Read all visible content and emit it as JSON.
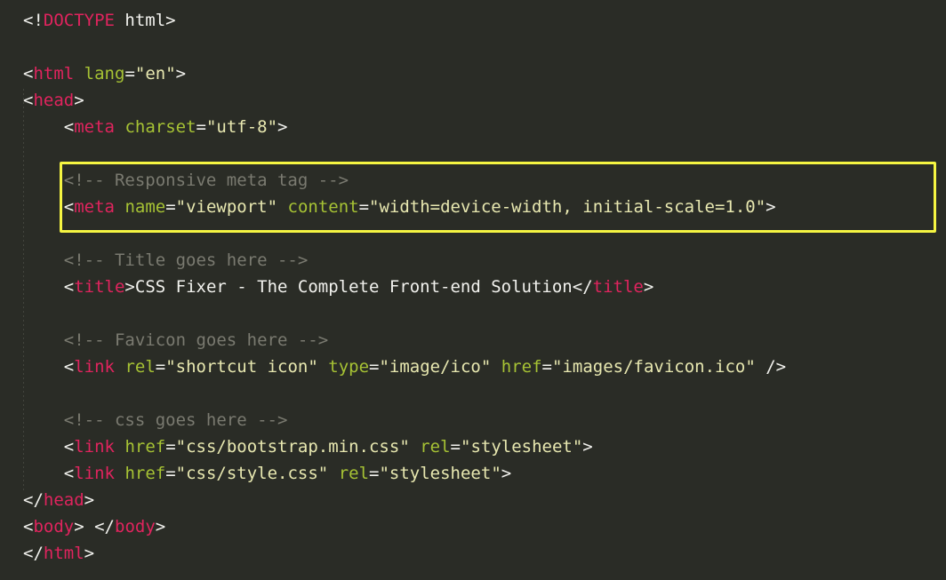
{
  "editor": {
    "language": "html",
    "background_color": "#2a2c26",
    "default_text_color": "#f2f2ee",
    "font_size_px": 19,
    "line_height_px": 30,
    "colors": {
      "tag": "#e0245e",
      "attribute_name": "#a6c234",
      "attribute_value": "#e8e8b0",
      "comment": "#7a7a70",
      "punctuation": "#f2f2ee",
      "text": "#f2f2ee",
      "highlight_border": "#f5f542",
      "indent_guide": "#43453d"
    }
  },
  "highlight": {
    "label": "viewport-meta-emphasis",
    "border_color": "#f5f542",
    "covers_lines": [
      6,
      7
    ]
  },
  "code": {
    "lines": [
      {
        "n": 1,
        "text": "<!DOCTYPE html>",
        "tokens": [
          {
            "t": "punct",
            "v": "<!"
          },
          {
            "t": "tag",
            "v": "DOCTYPE"
          },
          {
            "t": "text",
            "v": " html"
          },
          {
            "t": "punct",
            "v": ">"
          }
        ]
      },
      {
        "n": 2,
        "text": "",
        "tokens": []
      },
      {
        "n": 3,
        "text": "<html lang=\"en\">",
        "tokens": [
          {
            "t": "punct",
            "v": "<"
          },
          {
            "t": "tag",
            "v": "html"
          },
          {
            "t": "text",
            "v": " "
          },
          {
            "t": "attr",
            "v": "lang"
          },
          {
            "t": "punct",
            "v": "="
          },
          {
            "t": "string",
            "v": "\"en\""
          },
          {
            "t": "punct",
            "v": ">"
          }
        ]
      },
      {
        "n": 4,
        "text": "<head>",
        "tokens": [
          {
            "t": "punct",
            "v": "<"
          },
          {
            "t": "tag",
            "v": "head"
          },
          {
            "t": "punct",
            "v": ">"
          }
        ]
      },
      {
        "n": 5,
        "text": "    <meta charset=\"utf-8\">",
        "tokens": [
          {
            "t": "text",
            "v": "    "
          },
          {
            "t": "punct",
            "v": "<"
          },
          {
            "t": "tag",
            "v": "meta"
          },
          {
            "t": "text",
            "v": " "
          },
          {
            "t": "attr",
            "v": "charset"
          },
          {
            "t": "punct",
            "v": "="
          },
          {
            "t": "string",
            "v": "\"utf-8\""
          },
          {
            "t": "punct",
            "v": ">"
          }
        ]
      },
      {
        "n": 6,
        "text": "",
        "tokens": []
      },
      {
        "n": 7,
        "text": "    <!-- Responsive meta tag -->",
        "tokens": [
          {
            "t": "text",
            "v": "    "
          },
          {
            "t": "comment",
            "v": "<!-- Responsive meta tag -->"
          }
        ]
      },
      {
        "n": 8,
        "text": "    <meta name=\"viewport\" content=\"width=device-width, initial-scale=1.0\">",
        "tokens": [
          {
            "t": "text",
            "v": "    "
          },
          {
            "t": "punct",
            "v": "<"
          },
          {
            "t": "tag",
            "v": "meta"
          },
          {
            "t": "text",
            "v": " "
          },
          {
            "t": "attr",
            "v": "name"
          },
          {
            "t": "punct",
            "v": "="
          },
          {
            "t": "string",
            "v": "\"viewport\""
          },
          {
            "t": "text",
            "v": " "
          },
          {
            "t": "attr",
            "v": "content"
          },
          {
            "t": "punct",
            "v": "="
          },
          {
            "t": "string",
            "v": "\"width=device-width, initial-scale=1.0\""
          },
          {
            "t": "punct",
            "v": ">"
          }
        ]
      },
      {
        "n": 9,
        "text": "",
        "tokens": []
      },
      {
        "n": 10,
        "text": "    <!-- Title goes here -->",
        "tokens": [
          {
            "t": "text",
            "v": "    "
          },
          {
            "t": "comment",
            "v": "<!-- Title goes here -->"
          }
        ]
      },
      {
        "n": 11,
        "text": "    <title>CSS Fixer - The Complete Front-end Solution</title>",
        "tokens": [
          {
            "t": "text",
            "v": "    "
          },
          {
            "t": "punct",
            "v": "<"
          },
          {
            "t": "tag",
            "v": "title"
          },
          {
            "t": "punct",
            "v": ">"
          },
          {
            "t": "text",
            "v": "CSS Fixer - The Complete Front-end Solution"
          },
          {
            "t": "punct",
            "v": "</"
          },
          {
            "t": "tag",
            "v": "title"
          },
          {
            "t": "punct",
            "v": ">"
          }
        ]
      },
      {
        "n": 12,
        "text": "",
        "tokens": []
      },
      {
        "n": 13,
        "text": "    <!-- Favicon goes here -->",
        "tokens": [
          {
            "t": "text",
            "v": "    "
          },
          {
            "t": "comment",
            "v": "<!-- Favicon goes here -->"
          }
        ]
      },
      {
        "n": 14,
        "text": "    <link rel=\"shortcut icon\" type=\"image/ico\" href=\"images/favicon.ico\" />",
        "tokens": [
          {
            "t": "text",
            "v": "    "
          },
          {
            "t": "punct",
            "v": "<"
          },
          {
            "t": "tag",
            "v": "link"
          },
          {
            "t": "text",
            "v": " "
          },
          {
            "t": "attr",
            "v": "rel"
          },
          {
            "t": "punct",
            "v": "="
          },
          {
            "t": "string",
            "v": "\"shortcut icon\""
          },
          {
            "t": "text",
            "v": " "
          },
          {
            "t": "attr",
            "v": "type"
          },
          {
            "t": "punct",
            "v": "="
          },
          {
            "t": "string",
            "v": "\"image/ico\""
          },
          {
            "t": "text",
            "v": " "
          },
          {
            "t": "attr",
            "v": "href"
          },
          {
            "t": "punct",
            "v": "="
          },
          {
            "t": "string",
            "v": "\"images/favicon.ico\""
          },
          {
            "t": "punct",
            "v": " />"
          }
        ]
      },
      {
        "n": 15,
        "text": "",
        "tokens": []
      },
      {
        "n": 16,
        "text": "    <!-- css goes here -->",
        "tokens": [
          {
            "t": "text",
            "v": "    "
          },
          {
            "t": "comment",
            "v": "<!-- css goes here -->"
          }
        ]
      },
      {
        "n": 17,
        "text": "    <link href=\"css/bootstrap.min.css\" rel=\"stylesheet\">",
        "tokens": [
          {
            "t": "text",
            "v": "    "
          },
          {
            "t": "punct",
            "v": "<"
          },
          {
            "t": "tag",
            "v": "link"
          },
          {
            "t": "text",
            "v": " "
          },
          {
            "t": "attr",
            "v": "href"
          },
          {
            "t": "punct",
            "v": "="
          },
          {
            "t": "string",
            "v": "\"css/bootstrap.min.css\""
          },
          {
            "t": "text",
            "v": " "
          },
          {
            "t": "attr",
            "v": "rel"
          },
          {
            "t": "punct",
            "v": "="
          },
          {
            "t": "string",
            "v": "\"stylesheet\""
          },
          {
            "t": "punct",
            "v": ">"
          }
        ]
      },
      {
        "n": 18,
        "text": "    <link href=\"css/style.css\" rel=\"stylesheet\">",
        "tokens": [
          {
            "t": "text",
            "v": "    "
          },
          {
            "t": "punct",
            "v": "<"
          },
          {
            "t": "tag",
            "v": "link"
          },
          {
            "t": "text",
            "v": " "
          },
          {
            "t": "attr",
            "v": "href"
          },
          {
            "t": "punct",
            "v": "="
          },
          {
            "t": "string",
            "v": "\"css/style.css\""
          },
          {
            "t": "text",
            "v": " "
          },
          {
            "t": "attr",
            "v": "rel"
          },
          {
            "t": "punct",
            "v": "="
          },
          {
            "t": "string",
            "v": "\"stylesheet\""
          },
          {
            "t": "punct",
            "v": ">"
          }
        ]
      },
      {
        "n": 19,
        "text": "</head>",
        "tokens": [
          {
            "t": "punct",
            "v": "</"
          },
          {
            "t": "tag",
            "v": "head"
          },
          {
            "t": "punct",
            "v": ">"
          }
        ]
      },
      {
        "n": 20,
        "text": "<body> </body>",
        "tokens": [
          {
            "t": "punct",
            "v": "<"
          },
          {
            "t": "tag",
            "v": "body"
          },
          {
            "t": "punct",
            "v": "> "
          },
          {
            "t": "punct",
            "v": "</"
          },
          {
            "t": "tag",
            "v": "body"
          },
          {
            "t": "punct",
            "v": ">"
          }
        ]
      },
      {
        "n": 21,
        "text": "</html>",
        "tokens": [
          {
            "t": "punct",
            "v": "</"
          },
          {
            "t": "tag",
            "v": "html"
          },
          {
            "t": "punct",
            "v": ">"
          }
        ]
      }
    ]
  }
}
